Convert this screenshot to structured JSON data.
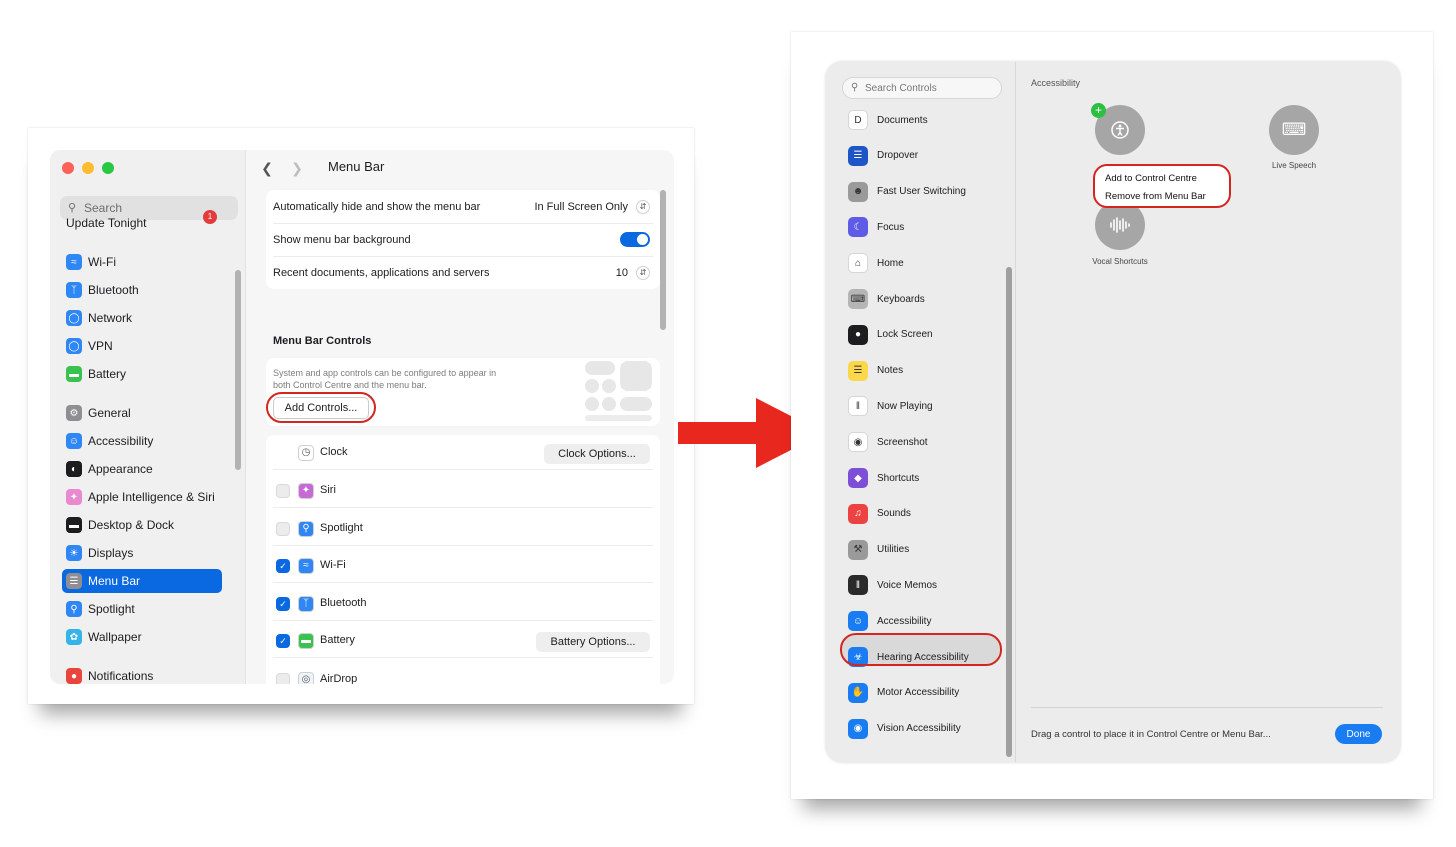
{
  "left_window": {
    "search_placeholder": "Search",
    "update_label": "Update Tonight",
    "update_badge": "1",
    "sidebar": [
      {
        "label": "Wi-Fi",
        "icon": "wifi-icon",
        "color": "#2f86f5"
      },
      {
        "label": "Bluetooth",
        "icon": "bluetooth-icon",
        "color": "#2f86f5"
      },
      {
        "label": "Network",
        "icon": "globe-icon",
        "color": "#2f86f5"
      },
      {
        "label": "VPN",
        "icon": "globe-lock-icon",
        "color": "#2f86f5"
      },
      {
        "label": "Battery",
        "icon": "battery-icon",
        "color": "#37c34e"
      },
      {
        "label": "General",
        "icon": "gear-icon",
        "color": "#8e8e93"
      },
      {
        "label": "Accessibility",
        "icon": "accessibility-icon",
        "color": "#2f86f5"
      },
      {
        "label": "Appearance",
        "icon": "appearance-icon",
        "color": "#1d1d1f"
      },
      {
        "label": "Apple Intelligence & Siri",
        "icon": "siri-icon",
        "color": "#e98ad0"
      },
      {
        "label": "Desktop & Dock",
        "icon": "dock-icon",
        "color": "#1d1d1f"
      },
      {
        "label": "Displays",
        "icon": "sun-icon",
        "color": "#2f86f5"
      },
      {
        "label": "Menu Bar",
        "icon": "menubar-icon",
        "color": "#8e8e93"
      },
      {
        "label": "Spotlight",
        "icon": "magnifier-icon",
        "color": "#2f86f5"
      },
      {
        "label": "Wallpaper",
        "icon": "flower-icon",
        "color": "#35b4e8"
      },
      {
        "label": "Notifications",
        "icon": "bell-icon",
        "color": "#e8453c"
      }
    ],
    "selected_item": "Menu Bar",
    "title": "Menu Bar",
    "settings": {
      "auto_hide_label": "Automatically hide and show the menu bar",
      "auto_hide_value": "In Full Screen Only",
      "background_label": "Show menu bar background",
      "background_on": true,
      "recent_label": "Recent documents, applications and servers",
      "recent_value": "10"
    },
    "controls_heading": "Menu Bar Controls",
    "controls_desc": "System and app controls can be configured to appear in both Control Centre and the menu bar.",
    "add_controls_label": "Add Controls...",
    "controls": [
      {
        "label": "Clock",
        "checked": null,
        "option": "Clock Options...",
        "color": "#ffffff"
      },
      {
        "label": "Siri",
        "checked": false,
        "option": "",
        "color": "#c76ad6"
      },
      {
        "label": "Spotlight",
        "checked": false,
        "option": "",
        "color": "#2f86f5"
      },
      {
        "label": "Wi-Fi",
        "checked": true,
        "option": "",
        "color": "#2f86f5"
      },
      {
        "label": "Bluetooth",
        "checked": true,
        "option": "",
        "color": "#2f86f5"
      },
      {
        "label": "Battery",
        "checked": true,
        "option": "Battery Options...",
        "color": "#37c34e"
      },
      {
        "label": "AirDrop",
        "checked": false,
        "option": "",
        "color": "#eef4fb"
      }
    ]
  },
  "right_window": {
    "search_placeholder": "Search Controls",
    "sidebar": [
      {
        "label": "Documents",
        "icon": "documents-icon",
        "color": "#ffffff"
      },
      {
        "label": "Dropover",
        "icon": "dropover-icon",
        "color": "#1e56c7"
      },
      {
        "label": "Fast User Switching",
        "icon": "user-icon",
        "color": "#9a9a9a"
      },
      {
        "label": "Focus",
        "icon": "moon-icon",
        "color": "#5e5ce6"
      },
      {
        "label": "Home",
        "icon": "house-icon",
        "color": "#ffffff"
      },
      {
        "label": "Keyboards",
        "icon": "keyboard-icon",
        "color": "#b5b5b5"
      },
      {
        "label": "Lock Screen",
        "icon": "lock-icon",
        "color": "#1d1d1f"
      },
      {
        "label": "Notes",
        "icon": "notes-icon",
        "color": "#fbd74a"
      },
      {
        "label": "Now Playing",
        "icon": "waveform-icon",
        "color": "#ffffff"
      },
      {
        "label": "Screenshot",
        "icon": "camera-icon",
        "color": "#ffffff"
      },
      {
        "label": "Shortcuts",
        "icon": "shortcuts-icon",
        "color": "#7c4fd6"
      },
      {
        "label": "Sounds",
        "icon": "speaker-icon",
        "color": "#ec4242"
      },
      {
        "label": "Utilities",
        "icon": "tools-icon",
        "color": "#9a9a9a"
      },
      {
        "label": "Voice Memos",
        "icon": "voicememo-icon",
        "color": "#2a2a2a"
      },
      {
        "label": "Accessibility",
        "icon": "accessibility-icon",
        "color": "#1a7cf2"
      },
      {
        "label": "Hearing Accessibility",
        "icon": "ear-icon",
        "color": "#1a7cf2"
      },
      {
        "label": "Motor Accessibility",
        "icon": "hand-icon",
        "color": "#1a7cf2"
      },
      {
        "label": "Vision Accessibility",
        "icon": "eye-icon",
        "color": "#1a7cf2"
      }
    ],
    "selected_item": "Accessibility",
    "heading": "Accessibility",
    "controls": [
      {
        "label": "Live Speech",
        "icon": "keyboard-wave-icon"
      },
      {
        "label": "Vocal Shortcuts",
        "icon": "waveform-icon"
      }
    ],
    "context_menu": [
      "Add to Control Centre",
      "Remove from Menu Bar"
    ],
    "footer_text": "Drag a control to place it in Control Centre or Menu Bar...",
    "done_label": "Done"
  },
  "colors": {
    "accent": "#0a68e0",
    "highlight": "#d42620",
    "arrow": "#e8271e"
  }
}
